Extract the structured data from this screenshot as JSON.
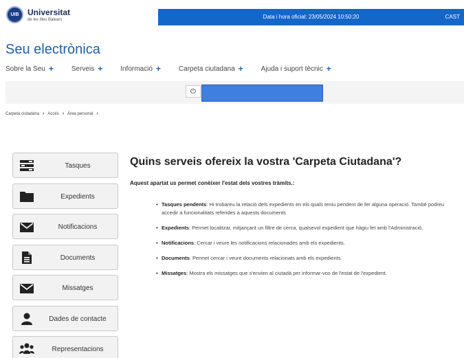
{
  "header": {
    "logo_seal": "UIB",
    "logo_title": "Universitat",
    "logo_subtitle": "de les Illes Balears",
    "official_date": "Data i hora oficial: 23/05/2024  10:50:20",
    "language": "CAST",
    "bar_color": "#1566c9"
  },
  "site": {
    "title": "Seu electrònica",
    "title_color": "#1f5ea8"
  },
  "nav": [
    {
      "label": "Sobre la Seu",
      "icon": "plus-icon"
    },
    {
      "label": "Serveis",
      "icon": "plus-icon"
    },
    {
      "label": "Informació",
      "icon": "plus-icon"
    },
    {
      "label": "Carpeta ciutadana",
      "icon": "plus-icon"
    },
    {
      "label": "Ajuda i suport tècnic",
      "icon": "plus-icon"
    }
  ],
  "nav_plus": "+",
  "userbar": {
    "power_glyph": "⏻"
  },
  "breadcrumb": [
    "Carpeta ciutadana",
    "Accés",
    "Àrea personal"
  ],
  "breadcrumb_sep": "›",
  "sidebar": [
    {
      "label": "Tasques",
      "icon": "tasks-icon"
    },
    {
      "label": "Expedients",
      "icon": "folder-icon"
    },
    {
      "label": "Notificacions",
      "icon": "envelope-icon"
    },
    {
      "label": "Documents",
      "icon": "document-icon"
    },
    {
      "label": "Missatges",
      "icon": "envelope-icon"
    },
    {
      "label": "Dades de contacte",
      "icon": "user-icon"
    },
    {
      "label": "Representacions",
      "icon": "users-icon"
    }
  ],
  "main": {
    "heading": "Quins serveis ofereix la vostra 'Carpeta Ciutadana'?",
    "intro": "Aquest apartat us permet conèixer l'estat dels vostres tràmits.:",
    "features": [
      {
        "term": "Tasques pendents",
        "text": ": Hi trobareu la relació dels expedients en els quals teniu pendent de fer alguna operació. També podreu accedir a funcionalitats referides a aquests documents"
      },
      {
        "term": "Expedients",
        "text": ": Permet localitzar, mitjançant un filtre de cerca, qualsevol expedient que hàgiu fet amb l'Administració."
      },
      {
        "term": "Notificacions",
        "text": ": Cercar i veure les notificacions relacionades amb els expedients."
      },
      {
        "term": "Documents",
        "text": ": Permet cercar i veure documents relacionats amb els expedients."
      },
      {
        "term": "Missatges",
        "text": ": Mostra els missatges que s'envien al ciutadà per informar-vos de l'estat de l'expedient."
      }
    ]
  }
}
